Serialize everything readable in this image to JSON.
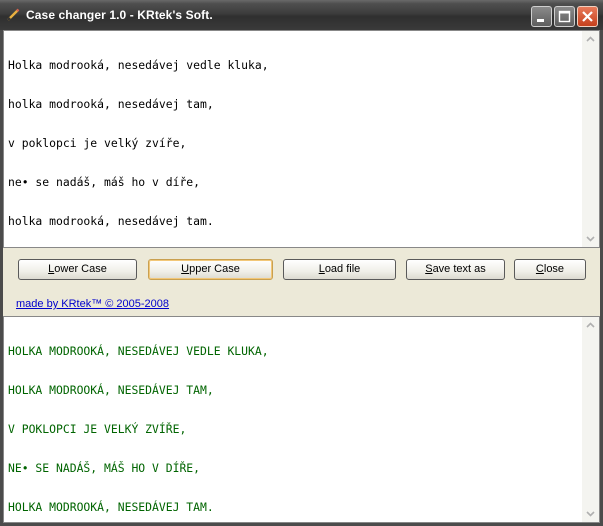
{
  "window": {
    "title": "Case changer 1.0 - KRtek's Soft.",
    "title_color": "#ffffff",
    "titlebar_color": "#3c3c3c"
  },
  "top_text": {
    "lines": [
      "Holka modrooká, nesedávej vedle kluka,",
      "holka modrooká, nesedávej tam,",
      "v poklopci je velký zvíře,",
      "ne• se nadáš, máš ho v díře,",
      "holka modrooká, nesedávej tam."
    ]
  },
  "buttons": {
    "lower_case": {
      "first": "L",
      "rest": "ower Case"
    },
    "upper_case": {
      "first": "U",
      "rest": "pper Case"
    },
    "load_file": {
      "first": "L",
      "rest": "oad file"
    },
    "save_text": {
      "first": "S",
      "rest": "ave text as"
    },
    "close": {
      "first": "C",
      "rest": "lose"
    }
  },
  "credit_link": "made by KRtek™ © 2005-2008",
  "bottom_text": {
    "color": "#006400",
    "lines": [
      "HOLKA MODROOKÁ, NESEDÁVEJ VEDLE KLUKA,",
      "HOLKA MODROOKÁ, NESEDÁVEJ TAM,",
      "V POKLOPCI JE VELKÝ ZVÍŘE,",
      "NE• SE NADÁŠ, MÁŠ HO V DÍŘE,",
      "HOLKA MODROOKÁ, NESEDÁVEJ TAM."
    ]
  },
  "icons": {
    "app": "pencil-icon",
    "minimize": "minimize-icon",
    "maximize": "maximize-icon",
    "close": "close-icon"
  }
}
